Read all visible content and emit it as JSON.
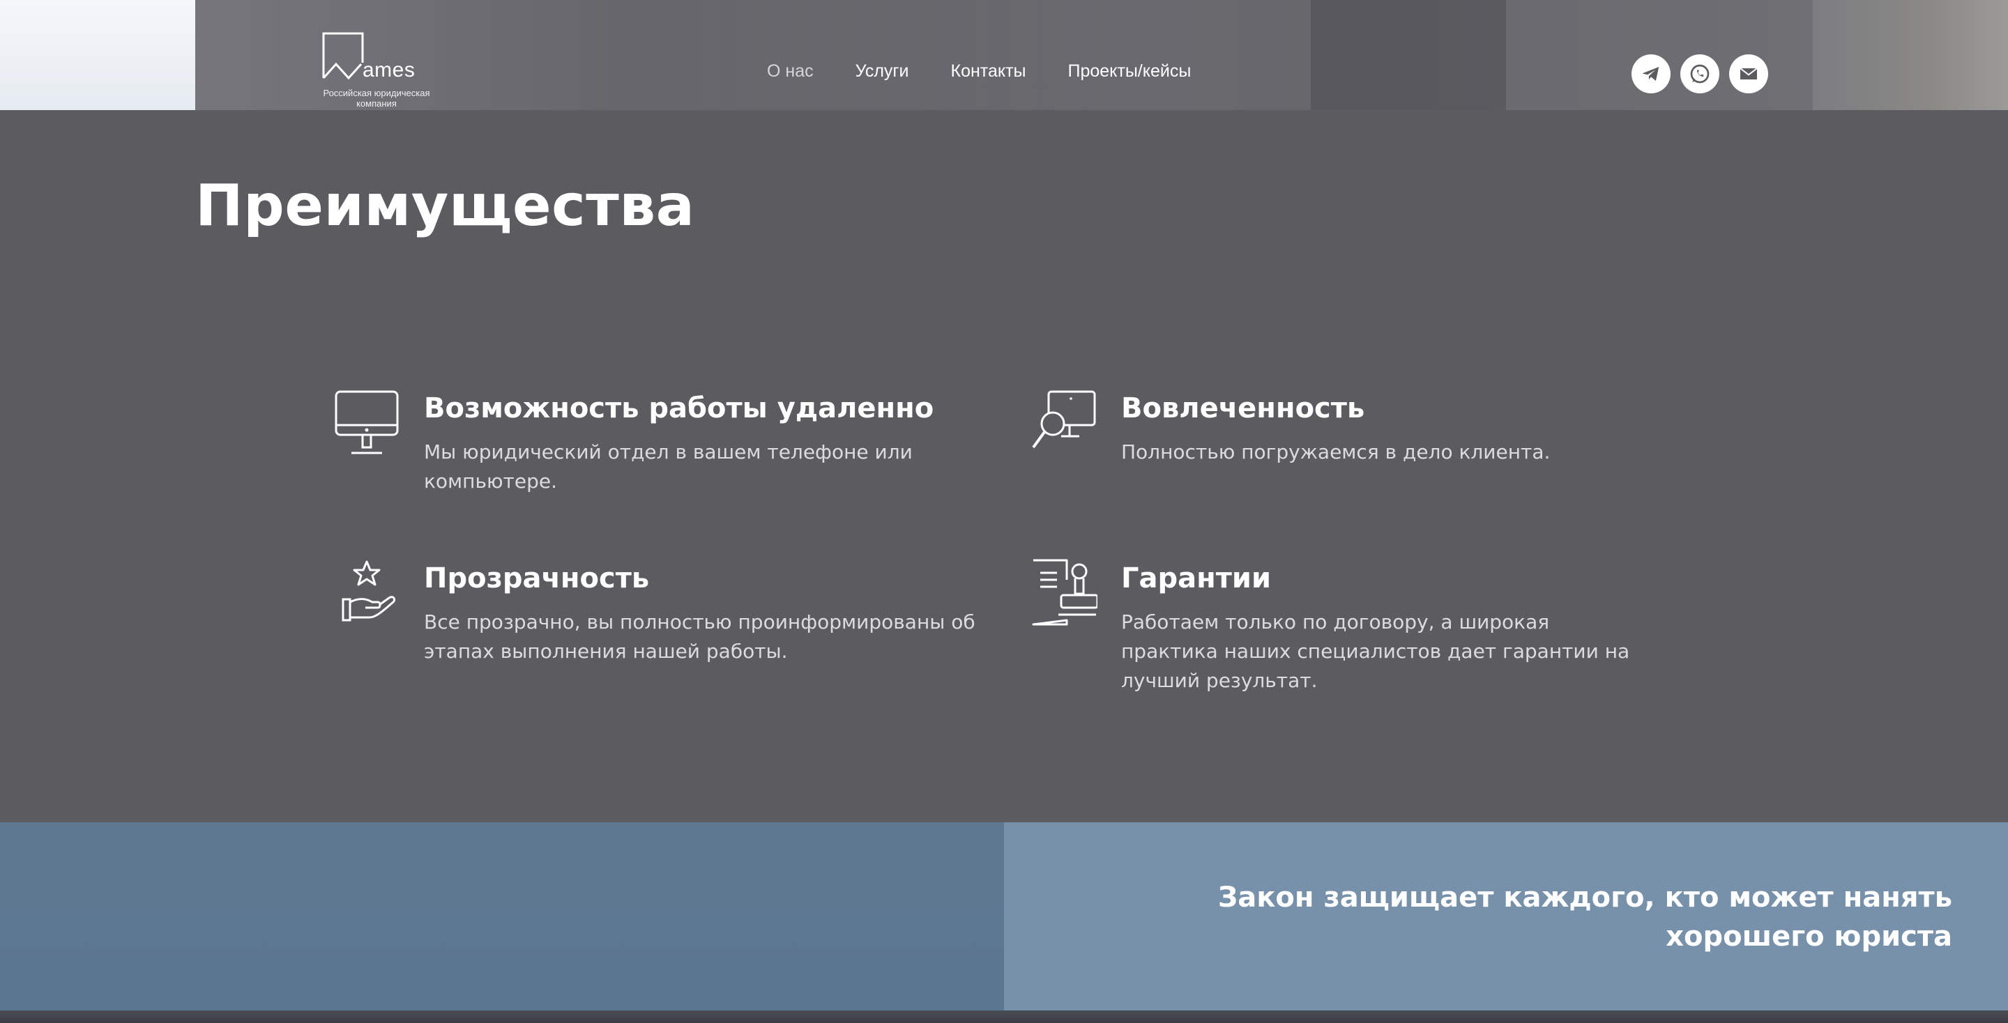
{
  "header": {
    "logo": {
      "name": "ames",
      "subtitle_line1": "Российская юридическая",
      "subtitle_line2": "компания"
    },
    "nav": [
      {
        "label": "О нас",
        "active": false
      },
      {
        "label": "Услуги"
      },
      {
        "label": "Контакты"
      },
      {
        "label": "Проекты/кейсы"
      }
    ],
    "socials": [
      {
        "icon": "telegram-icon"
      },
      {
        "icon": "whatsapp-icon"
      },
      {
        "icon": "mail-icon"
      }
    ]
  },
  "advantages": {
    "title": "Преимущества",
    "items": [
      {
        "icon": "monitor-icon",
        "heading": "Возможность работы удаленно",
        "text": "Мы юридический отдел в вашем телефоне или компьютере."
      },
      {
        "icon": "search-monitor-icon",
        "heading": "Вовлеченность",
        "text": "Полностью погружаемся в дело клиента."
      },
      {
        "icon": "hand-star-icon",
        "heading": "Прозрачность",
        "text": "Все прозрачно, вы полностью проинформированы об этапах выполнения нашей работы."
      },
      {
        "icon": "document-stamp-icon",
        "heading": "Гарантии",
        "text": "Работаем только по договору, а широкая практика наших специалистов дает гарантии на лучший результат."
      }
    ]
  },
  "banner": {
    "quote": "Закон защищает каждого, кто может нанять хорошего юриста"
  },
  "colors": {
    "page_bg": "#5c5b60",
    "banner_left": "#5b7690",
    "banner_right": "#7791ab",
    "text": "#ffffff"
  }
}
